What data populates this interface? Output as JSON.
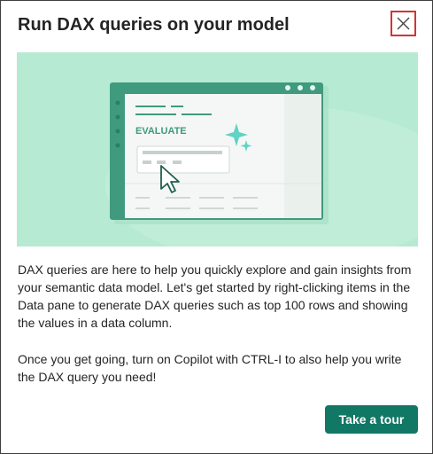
{
  "dialog": {
    "title": "Run DAX queries on your model",
    "close_icon": "close-icon",
    "illustration": {
      "label": "EVALUATE",
      "icons": [
        "sparkle-icon",
        "cursor-arrow-icon"
      ]
    },
    "paragraph1": "DAX queries are here to help you quickly explore and gain insights from your semantic data model. Let's get started by right-clicking items in the Data pane to generate DAX queries such as top 100 rows and showing the values in a data column.",
    "paragraph2": "Once you get going, turn on Copilot with CTRL-I to also help you write the DAX query you need!",
    "primary_button": "Take a tour"
  },
  "colors": {
    "accent": "#117865",
    "illustration_bg": "#b7ead3",
    "close_highlight": "#d13438"
  }
}
